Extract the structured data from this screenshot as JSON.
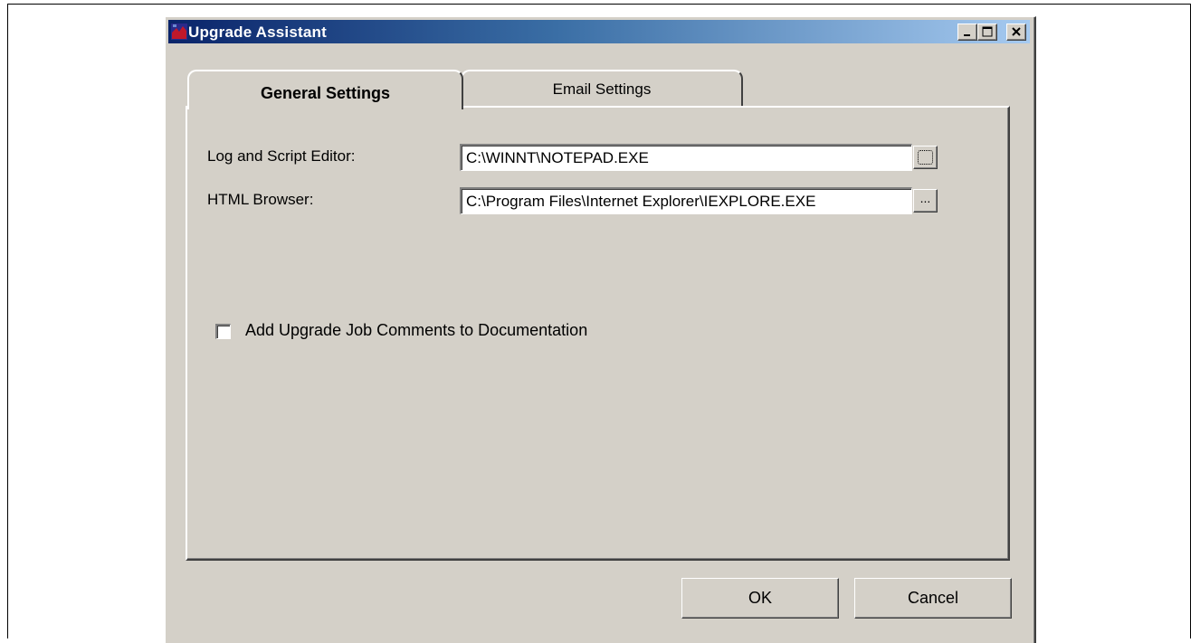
{
  "window": {
    "title": "Upgrade Assistant"
  },
  "caption_buttons": {
    "minimize": "minimize-icon",
    "maximize": "maximize-icon",
    "close": "close-icon"
  },
  "tabs": [
    {
      "label": "General Settings",
      "active": true
    },
    {
      "label": "Email Settings",
      "active": false
    }
  ],
  "general": {
    "editor_label": "Log and Script Editor:",
    "editor_value": "C:\\WINNT\\NOTEPAD.EXE",
    "browser_label": "HTML Browser:",
    "browser_value": "C:\\Program Files\\Internet Explorer\\IEXPLORE.EXE",
    "browse_label": "...",
    "comments_checkbox_label": "Add Upgrade Job Comments to Documentation",
    "comments_checked": false
  },
  "buttons": {
    "ok": "OK",
    "cancel": "Cancel"
  },
  "colors": {
    "face": "#d4d0c8",
    "title_start": "#0a246a",
    "title_end": "#a6caf0"
  }
}
